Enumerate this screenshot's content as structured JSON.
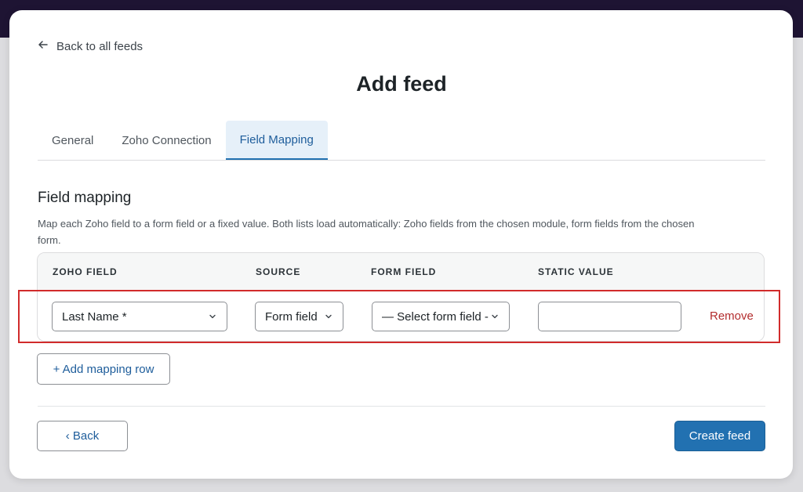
{
  "header": {
    "back_link": "Back to all feeds",
    "title": "Add feed"
  },
  "tabs": [
    {
      "label": "General",
      "active": false
    },
    {
      "label": "Zoho Connection",
      "active": false
    },
    {
      "label": "Field Mapping",
      "active": true
    }
  ],
  "section": {
    "title": "Field mapping",
    "description": "Map each Zoho field to a form field or a fixed value. Both lists load automatically: Zoho fields from the chosen module, form fields from the chosen form."
  },
  "table": {
    "columns": [
      "ZOHO FIELD",
      "SOURCE",
      "FORM FIELD",
      "STATIC VALUE"
    ],
    "rows": [
      {
        "zoho_field": "Last Name *",
        "source": "Form field",
        "form_field": "— Select form field -",
        "static_value": "",
        "remove_label": "Remove"
      }
    ]
  },
  "actions": {
    "add_row": "+ Add mapping row",
    "back": "‹ Back",
    "create": "Create feed"
  },
  "colors": {
    "accent": "#2271b1",
    "danger": "#b32d2e",
    "highlight": "#d12b2b"
  }
}
